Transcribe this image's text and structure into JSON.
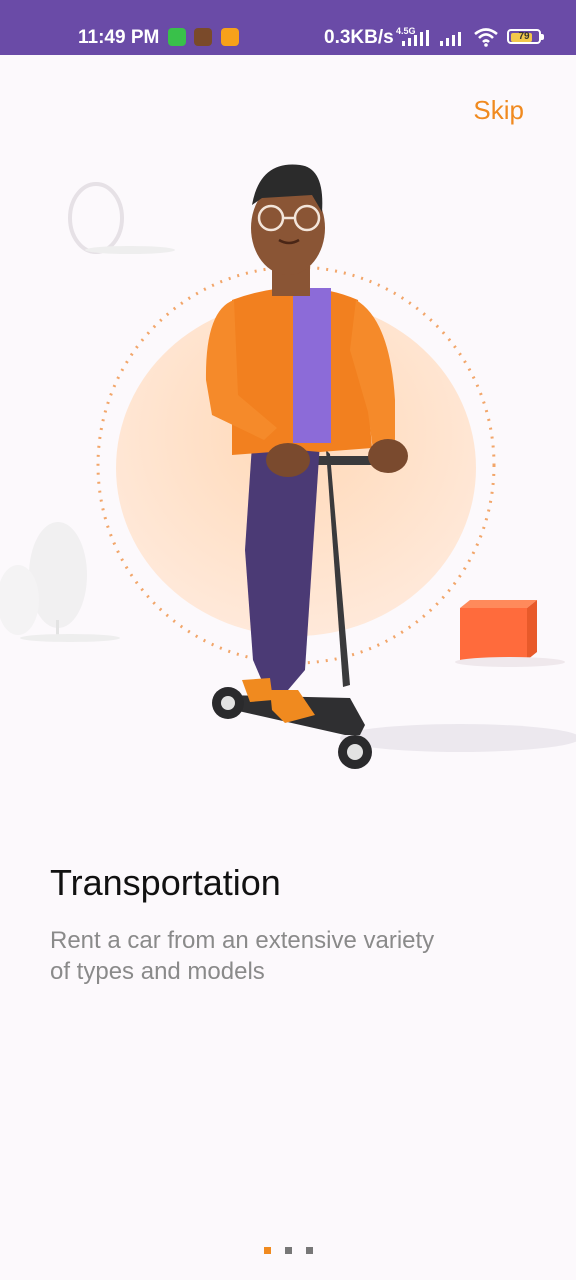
{
  "status_bar": {
    "time": "11:49 PM",
    "net_speed": "0.3KB/s",
    "network_type": "4.5G",
    "battery": "79",
    "battery_level": 0.79,
    "icons": [
      "notification-app-icon",
      "game-app-icon",
      "chat-app-icon",
      "signal-icon",
      "wifi-icon",
      "battery-icon"
    ]
  },
  "onboarding": {
    "skip_label": "Skip",
    "title": "Transportation",
    "description": "Rent a car from an extensive variety of types and models",
    "page_count": 3,
    "active_page": 1
  },
  "colors": {
    "accent": "#f08a1f",
    "status_bar": "#6a4ba7",
    "background": "#fcf9fc"
  }
}
